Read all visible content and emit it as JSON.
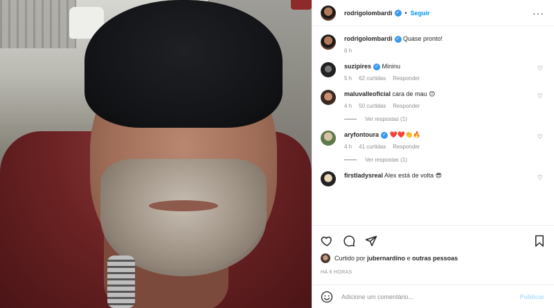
{
  "header": {
    "username": "rodrigolombardi",
    "separator": "•",
    "follow_label": "Seguir"
  },
  "caption": {
    "username": "rodrigolombardi",
    "text": "Quase pronto!",
    "time": "6 h"
  },
  "comments": [
    {
      "username": "suzipires",
      "verified": true,
      "text": "Mininu",
      "time": "5 h",
      "likes": "62 curtidas",
      "reply_label": "Responder"
    },
    {
      "username": "maluvalleoficial",
      "verified": false,
      "text": "cara de mau 😊",
      "time": "4 h",
      "likes": "50 curtidas",
      "reply_label": "Responder",
      "view_replies": "Ver respostas (1)"
    },
    {
      "username": "aryfontoura",
      "verified": true,
      "text": "❤️❤️👏🔥",
      "time": "4 h",
      "likes": "41 curtidas",
      "reply_label": "Responder",
      "view_replies": "Ver respostas (1)"
    },
    {
      "username": "firstladysreal",
      "verified": false,
      "text": "Alex está de volta 😎"
    }
  ],
  "likes": {
    "prefix": "Curtido por",
    "user": "jubernardino",
    "conj": "e",
    "others": "outras pessoas"
  },
  "timestamp": "HÁ 6 HORAS",
  "add_comment": {
    "placeholder": "Adicione um comentário...",
    "publish_label": "Publicar"
  },
  "colors": {
    "link": "#0095f6",
    "muted": "#8e8e8e",
    "verified": "#3897f0",
    "publish_disabled": "#b2dffc"
  }
}
